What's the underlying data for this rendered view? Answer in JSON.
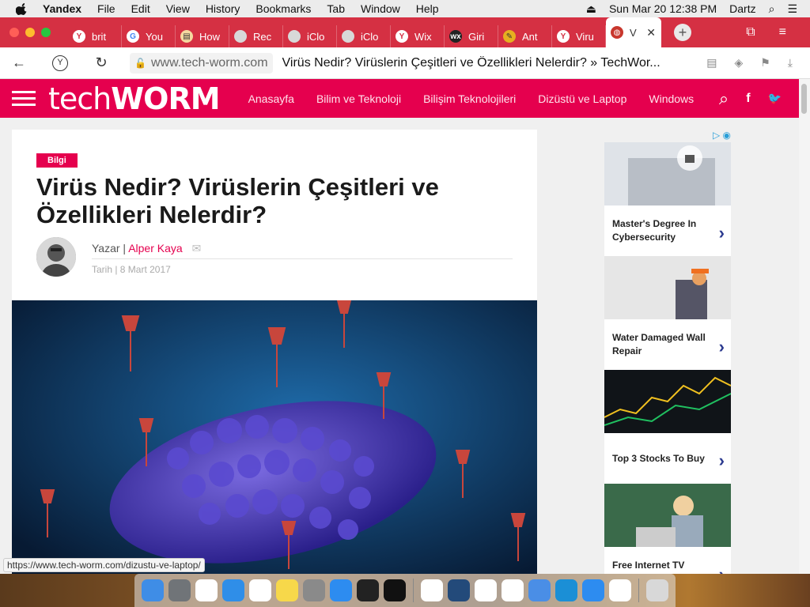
{
  "menubar": {
    "app_name": "Yandex",
    "items": [
      "File",
      "Edit",
      "View",
      "History",
      "Bookmarks",
      "Tab",
      "Window",
      "Help"
    ],
    "datetime": "Sun Mar 20  12:38 PM",
    "user": "Dartz"
  },
  "tabs": [
    {
      "label": "brit",
      "fav": "Y",
      "color": "#ffffff",
      "fg": "#d53043"
    },
    {
      "label": "You",
      "fav": "G",
      "color": "#ffffff",
      "fg": "#4285f4"
    },
    {
      "label": "How",
      "fav": "▤",
      "color": "#f5d9a0",
      "fg": "#333"
    },
    {
      "label": "Rec",
      "fav": "",
      "color": "#d8d8d8",
      "fg": "#333"
    },
    {
      "label": "iClo",
      "fav": "",
      "color": "#d8d8d8",
      "fg": "#333"
    },
    {
      "label": "iClo",
      "fav": "",
      "color": "#d8d8d8",
      "fg": "#333"
    },
    {
      "label": "Wix",
      "fav": "Y",
      "color": "#ffffff",
      "fg": "#d53043"
    },
    {
      "label": "Giri",
      "fav": "wx",
      "color": "#222222",
      "fg": "#fff"
    },
    {
      "label": "Ant",
      "fav": "✎",
      "color": "#e6b020",
      "fg": "#333"
    },
    {
      "label": "Viru",
      "fav": "Y",
      "color": "#ffffff",
      "fg": "#d53043"
    }
  ],
  "active_tab": {
    "label": "V",
    "close": "✕"
  },
  "address": {
    "url": "www.tech-worm.com",
    "page_title": "Virüs Nedir? Virüslerin Çeşitleri ve Özellikleri Nelerdir? » TechWor..."
  },
  "site": {
    "logo_thin": "tech",
    "logo_bold": "WORM",
    "nav": [
      "Anasayfa",
      "Bilim ve Teknoloji",
      "Bilişim Teknolojileri",
      "Dizüstü ve Laptop",
      "Windows"
    ]
  },
  "article": {
    "category": "Bilgi",
    "title": "Virüs Nedir? Virüslerin Çeşitleri ve Özellikleri Nelerdir?",
    "author_prefix": "Yazar | ",
    "author": "Alper Kaya",
    "date": "Tarih | 8 Mart 2017"
  },
  "ads": [
    {
      "text": "Master's Degree In Cybersecurity",
      "image": "laptop-lock"
    },
    {
      "text": "Water Damaged Wall Repair",
      "image": "worker-wall"
    },
    {
      "text": "Top 3 Stocks To Buy",
      "image": "stock-chart"
    },
    {
      "text": "Free Internet TV Streaming",
      "image": "woman-laptop"
    }
  ],
  "status_url": "https://www.tech-worm.com/dizustu-ve-laptop/",
  "colors": {
    "brand": "#e5004e",
    "tabbar": "#d53043",
    "ad_chevron": "#2b3a8f"
  },
  "dock": [
    {
      "name": "finder",
      "color": "#3f8de6"
    },
    {
      "name": "launchpad",
      "color": "#707478"
    },
    {
      "name": "chrome",
      "color": "#ffffff"
    },
    {
      "name": "safari",
      "color": "#2f8ee8"
    },
    {
      "name": "calendar",
      "color": "#ffffff"
    },
    {
      "name": "notes",
      "color": "#f7d84a"
    },
    {
      "name": "system-preferences",
      "color": "#8a8a8a"
    },
    {
      "name": "app-store",
      "color": "#2d8cf0"
    },
    {
      "name": "activity-monitor",
      "color": "#222222"
    },
    {
      "name": "terminal",
      "color": "#111111"
    },
    {
      "name": "office",
      "color": "#ffffff"
    },
    {
      "name": "shield",
      "color": "#234a7a"
    },
    {
      "name": "magnet",
      "color": "#ffffff"
    },
    {
      "name": "yandex",
      "color": "#ffffff"
    },
    {
      "name": "diamond-app",
      "color": "#4a8ee6"
    },
    {
      "name": "edge",
      "color": "#1b8fd6"
    },
    {
      "name": "app-store-downloads",
      "color": "#2d8cf0"
    },
    {
      "name": "magnet-2",
      "color": "#ffffff"
    },
    {
      "name": "trash",
      "color": "#d8d8d8"
    }
  ]
}
